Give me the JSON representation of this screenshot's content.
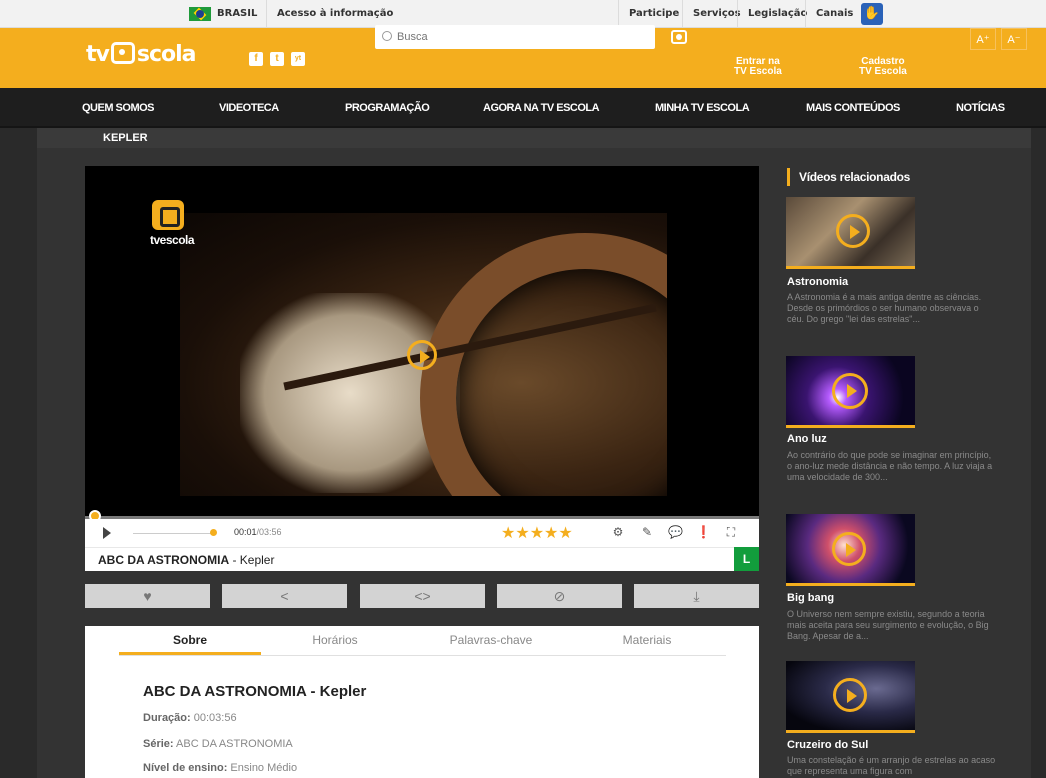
{
  "govbar": {
    "country": "BRASIL",
    "access": "Acesso à informação",
    "links": [
      "Participe",
      "Serviços",
      "Legislação",
      "Canais"
    ]
  },
  "header": {
    "logo": "tv escola",
    "search_placeholder": "Busca",
    "login_line1": "Entrar na",
    "login_line2": "TV Escola",
    "signup_line1": "Cadastro",
    "signup_line2": "TV Escola",
    "font_up": "A⁺",
    "font_down": "A⁻",
    "social": [
      "f",
      "t",
      "yt"
    ]
  },
  "nav": [
    "QUEM SOMOS",
    "VIDEOTECA",
    "PROGRAMAÇÃO",
    "AGORA NA TV ESCOLA",
    "MINHA TV ESCOLA",
    "MAIS CONTEÚDOS",
    "NOTÍCIAS"
  ],
  "page_title": "KEPLER",
  "player": {
    "overlay_logo": "tvescola",
    "time_current": "00:01",
    "time_total": "/03:56",
    "stars": "★★★★★",
    "caption_series": "ABC DA ASTRONOMIA",
    "caption_title": " - Kepler",
    "rating": "L"
  },
  "tabs": [
    "Sobre",
    "Horários",
    "Palavras-chave",
    "Materiais"
  ],
  "info": {
    "title": "ABC DA ASTRONOMIA - Kepler",
    "duration_label": "Duração:",
    "duration_value": " 00:03:56",
    "series_label": "Série:",
    "series_value": " ABC DA ASTRONOMIA",
    "level_label": "Nível de ensino:",
    "level_value": " Ensino Médio"
  },
  "sidebar": {
    "heading": "Vídeos relacionados",
    "videos": [
      {
        "title": "Astronomia",
        "desc": "A Astronomia é a mais antiga dentre as ciências. Desde os primórdios o ser humano observava o céu. Do grego \"lei das estrelas\"..."
      },
      {
        "title": "Ano luz",
        "desc": "Ao contrário do que pode se imaginar em princípio, o ano-luz mede distância e não tempo. A luz viaja a uma velocidade de 300..."
      },
      {
        "title": "Big bang",
        "desc": "O Universo nem sempre existiu, segundo a teoria mais aceita para seu surgimento e evolução, o Big Bang. Apesar de a..."
      },
      {
        "title": "Cruzeiro do Sul",
        "desc": "Uma constelação é um arranjo de estrelas ao acaso que representa uma figura com"
      }
    ]
  },
  "colors": {
    "accent": "#f4ae1e",
    "nav_bg": "#1e1e1e",
    "rating_green": "#129d3c"
  }
}
